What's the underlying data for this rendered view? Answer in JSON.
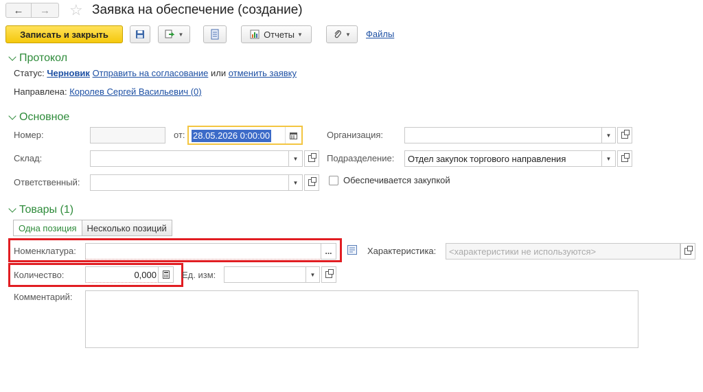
{
  "window": {
    "title": "Заявка на обеспечение (создание)",
    "back_icon": "←",
    "forward_icon": "→",
    "star_icon": "☆"
  },
  "toolbar": {
    "save_close_label": "Записать и закрыть",
    "reports_label": "Отчеты",
    "files_label": "Файлы"
  },
  "protocol": {
    "section_title": "Протокол",
    "status_label": "Статус:",
    "status_value": "Черновик",
    "send_link": "Отправить на согласование",
    "or_text": "или",
    "cancel_link": "отменить заявку",
    "sent_label": "Направлена:",
    "sent_value": "Королев Сергей Васильевич (0)"
  },
  "main": {
    "section_title": "Основное",
    "number_label": "Номер:",
    "number_value": "",
    "from_label": "от:",
    "date_value": "28.05.2026  0:00:00",
    "warehouse_label": "Склад:",
    "warehouse_value": "",
    "responsible_label": "Ответственный:",
    "responsible_value": "",
    "org_label": "Организация:",
    "org_value": "",
    "dept_label": "Подразделение:",
    "dept_value": "Отдел закупок торгового направления",
    "procurement_label": "Обеспечивается закупкой",
    "procurement_checked": false
  },
  "goods": {
    "section_title": "Товары (1)",
    "tab_single": "Одна позиция",
    "tab_multiple": "Несколько позиций",
    "nomenclature_label": "Номенклатура:",
    "nomenclature_value": "",
    "select_button": "...",
    "characteristic_label": "Характеристика:",
    "characteristic_placeholder": "<характеристики не используются>",
    "quantity_label": "Количество:",
    "quantity_value": "0,000",
    "unit_label": "Ед. изм:",
    "unit_value": "",
    "comment_label": "Комментарий:",
    "comment_value": ""
  },
  "colors": {
    "accent_green": "#2e8b3a",
    "link_blue": "#1c4fa3",
    "primary_yellow": "#f5c80c",
    "highlight_red": "#e11d22"
  }
}
